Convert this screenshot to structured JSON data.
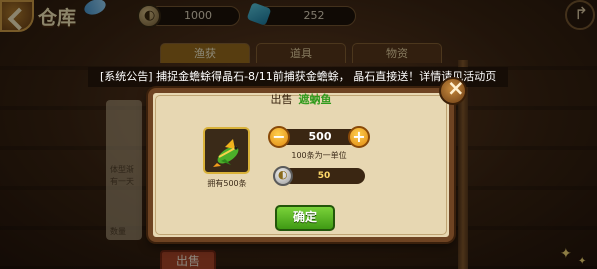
{
  "header": {
    "title": "仓库",
    "gold": "1000",
    "gems": "252"
  },
  "tabs": [
    {
      "label": "渔获",
      "active": true
    },
    {
      "label": "道具",
      "active": false
    },
    {
      "label": "物资",
      "active": false
    }
  ],
  "announcement": "[系统公告] 捕捉金蟾蜍得晶石-8/11前捕获金蟾蜍， 晶石直接送！详情请见活动页",
  "dialog": {
    "action_label": "出售",
    "item_name": "遮蚋鱼",
    "owned_text": "拥有500条",
    "quantity": "500",
    "unit_hint": "100条为一单位",
    "price": "50",
    "confirm_label": "确定",
    "minus_symbol": "−",
    "plus_symbol": "+"
  },
  "background": {
    "sell_label": "出售",
    "side_text_1": "体型渐",
    "side_text_2": "有一天",
    "side_text_3": "数量"
  },
  "colors": {
    "item_name": "#2f9a1c",
    "confirm": "#4fae1c",
    "stepper": "#f0a020",
    "dialog_bg": "#e7d7b2"
  },
  "icons": {
    "back": "back-arrow-icon",
    "gold": "coin-icon",
    "gem": "gem-icon",
    "share": "share-icon",
    "close": "close-icon",
    "item": "fish-icon"
  }
}
